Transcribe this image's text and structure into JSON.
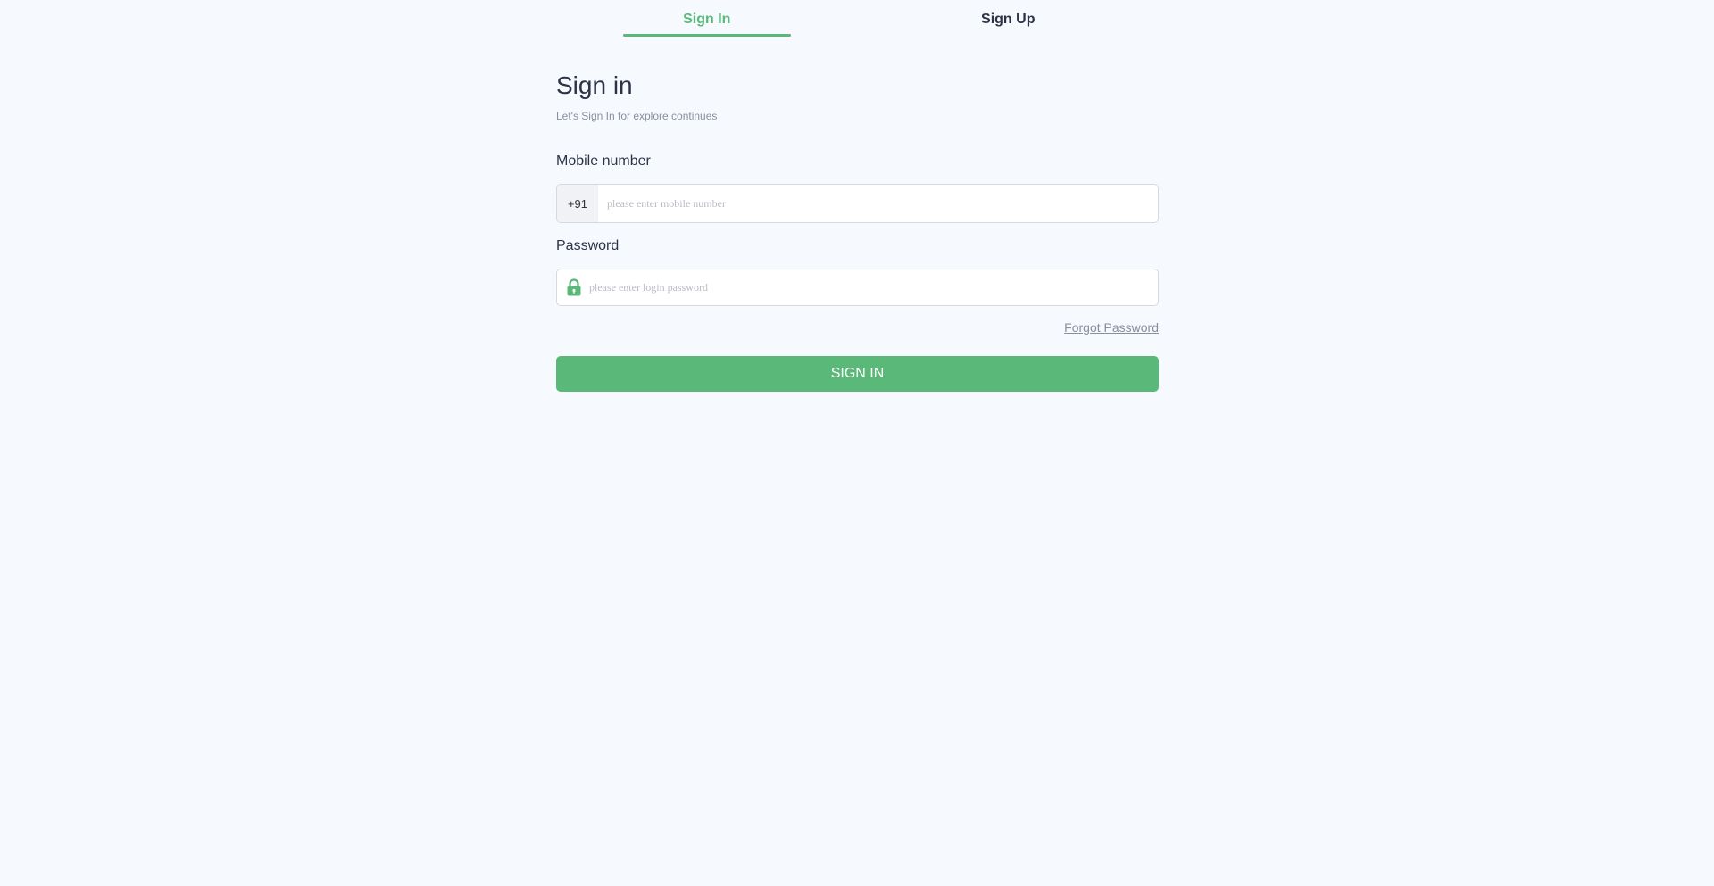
{
  "tabs": {
    "sign_in": "Sign In",
    "sign_up": "Sign Up"
  },
  "heading": {
    "title": "Sign in",
    "subtitle": "Let's Sign In for explore continues"
  },
  "mobile": {
    "label": "Mobile number",
    "country_code": "+91",
    "placeholder": "please enter mobile number",
    "value": ""
  },
  "password": {
    "label": "Password",
    "placeholder": "please enter login password",
    "value": "",
    "icon": "lock-icon"
  },
  "forgot_password": "Forgot Password",
  "submit_label": "SIGN IN",
  "colors": {
    "accent": "#5ab879",
    "text": "#2d3346",
    "muted": "#8a8f9e",
    "background": "#f6f9fe"
  }
}
